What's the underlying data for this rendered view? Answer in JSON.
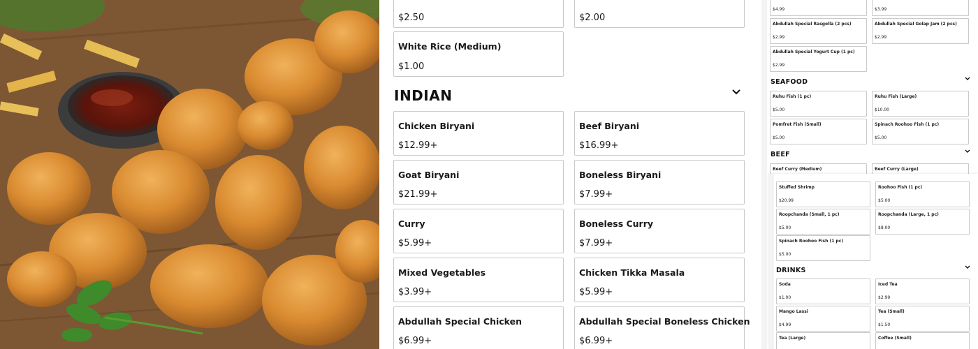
{
  "middle": {
    "top_prices": [
      "$2.50",
      "$2.00"
    ],
    "white_rice": {
      "name": "White Rice (Medium)",
      "price": "$1.00"
    },
    "section_title": "INDIAN",
    "indian_items": [
      {
        "name": "Chicken Biryani",
        "price": "$12.99+"
      },
      {
        "name": "Beef Biryani",
        "price": "$16.99+"
      },
      {
        "name": "Goat Biryani",
        "price": "$21.99+"
      },
      {
        "name": "Boneless Biryani",
        "price": "$7.99+"
      },
      {
        "name": "Curry",
        "price": "$5.99+"
      },
      {
        "name": "Boneless Curry",
        "price": "$7.99+"
      },
      {
        "name": "Mixed Vegetables",
        "price": "$3.99+"
      },
      {
        "name": "Chicken Tikka Masala",
        "price": "$5.99+"
      },
      {
        "name": "Abdullah Special Chicken",
        "price": "$6.99+"
      },
      {
        "name": "Abdullah Special Boneless Chicken",
        "price": "$6.99+"
      }
    ]
  },
  "preview": {
    "top_prices": [
      "$4.99",
      "$3.99"
    ],
    "desserts": [
      {
        "name": "Abdullah Special Rasgolla (2 pcs)",
        "price": "$2.99"
      },
      {
        "name": "Abdullah Special Golap Jam (2 pcs)",
        "price": "$2.99"
      },
      {
        "name": "Abdullah Special Yogurt Cup (1 pc)",
        "price": "$2.99"
      }
    ],
    "seafood_title": "SEAFOOD",
    "seafood": [
      {
        "name": "Ruhu Fish (1 pc)",
        "price": "$5.00"
      },
      {
        "name": "Ruhu Fish (Large)",
        "price": "$10.00"
      },
      {
        "name": "Pomfret Fish (Small)",
        "price": "$5.00"
      },
      {
        "name": "Spinach Roohoo Fish (1 pc)",
        "price": "$5.00"
      }
    ],
    "beef_title": "BEEF",
    "beef": [
      {
        "name": "Beef Curry (Medium)"
      },
      {
        "name": "Beef Curry (Large)"
      }
    ],
    "overlay_items": [
      {
        "name": "Stuffed Shrimp",
        "price": "$20.99"
      },
      {
        "name": "Roohoo Fish (1 pc)",
        "price": "$5.00"
      },
      {
        "name": "Roopchanda (Small, 1 pc)",
        "price": "$5.00"
      },
      {
        "name": "Roopchanda (Large, 1 pc)",
        "price": "$8.00"
      },
      {
        "name": "Spinach Roohoo Fish (1 pc)",
        "price": "$5.00"
      }
    ],
    "drinks_title": "DRINKS",
    "drinks": [
      {
        "name": "Soda",
        "price": "$1.00"
      },
      {
        "name": "Iced Tea",
        "price": "$2.99"
      },
      {
        "name": "Mango Lassi",
        "price": "$4.99"
      },
      {
        "name": "Tea (Small)",
        "price": "$1.50"
      },
      {
        "name": "Tea (Large)"
      },
      {
        "name": "Coffee (Small)"
      }
    ]
  },
  "icons": {
    "chevron": "chevron-down-icon"
  }
}
